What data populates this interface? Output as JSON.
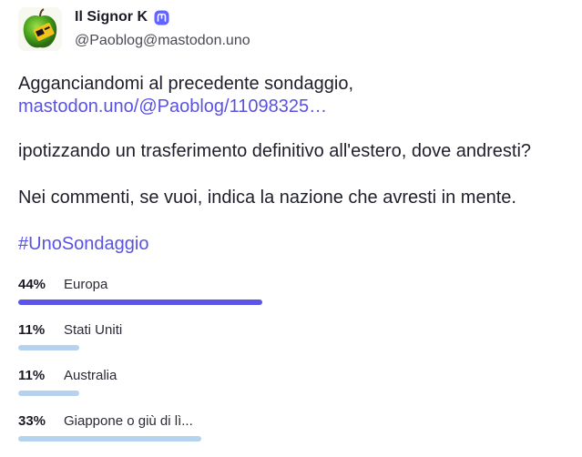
{
  "author": {
    "display_name": "Il Signor K",
    "handle": "@Paoblog@mastodon.uno"
  },
  "post": {
    "para1_text": "Agganciandomi al precedente sondaggio,",
    "para1_link": "mastodon.uno/@Paoblog/11098325…",
    "para2": "ipotizzando un trasferimento definitivo all'estero, dove andresti?",
    "para3": "Nei commenti, se vuoi, indica la nazione che avresti in mente.",
    "hashtag": "#UnoSondaggio"
  },
  "poll": {
    "options": [
      {
        "percent_label": "44%",
        "label": "Europa",
        "fraction": 0.44,
        "leading": true
      },
      {
        "percent_label": "11%",
        "label": "Stati Uniti",
        "fraction": 0.11,
        "leading": false
      },
      {
        "percent_label": "11%",
        "label": "Australia",
        "fraction": 0.11,
        "leading": false
      },
      {
        "percent_label": "33%",
        "label": "Giappone o giù di lì...",
        "fraction": 0.33,
        "leading": false
      }
    ]
  },
  "colors": {
    "link": "#5a52e0",
    "bar_leading": "#5c55e8",
    "bar_other": "#b5d3ef",
    "verified_badge": "#6364ff"
  },
  "icons": {
    "avatar": "green-apple-avatar",
    "verified": "mastodon-badge-icon"
  }
}
